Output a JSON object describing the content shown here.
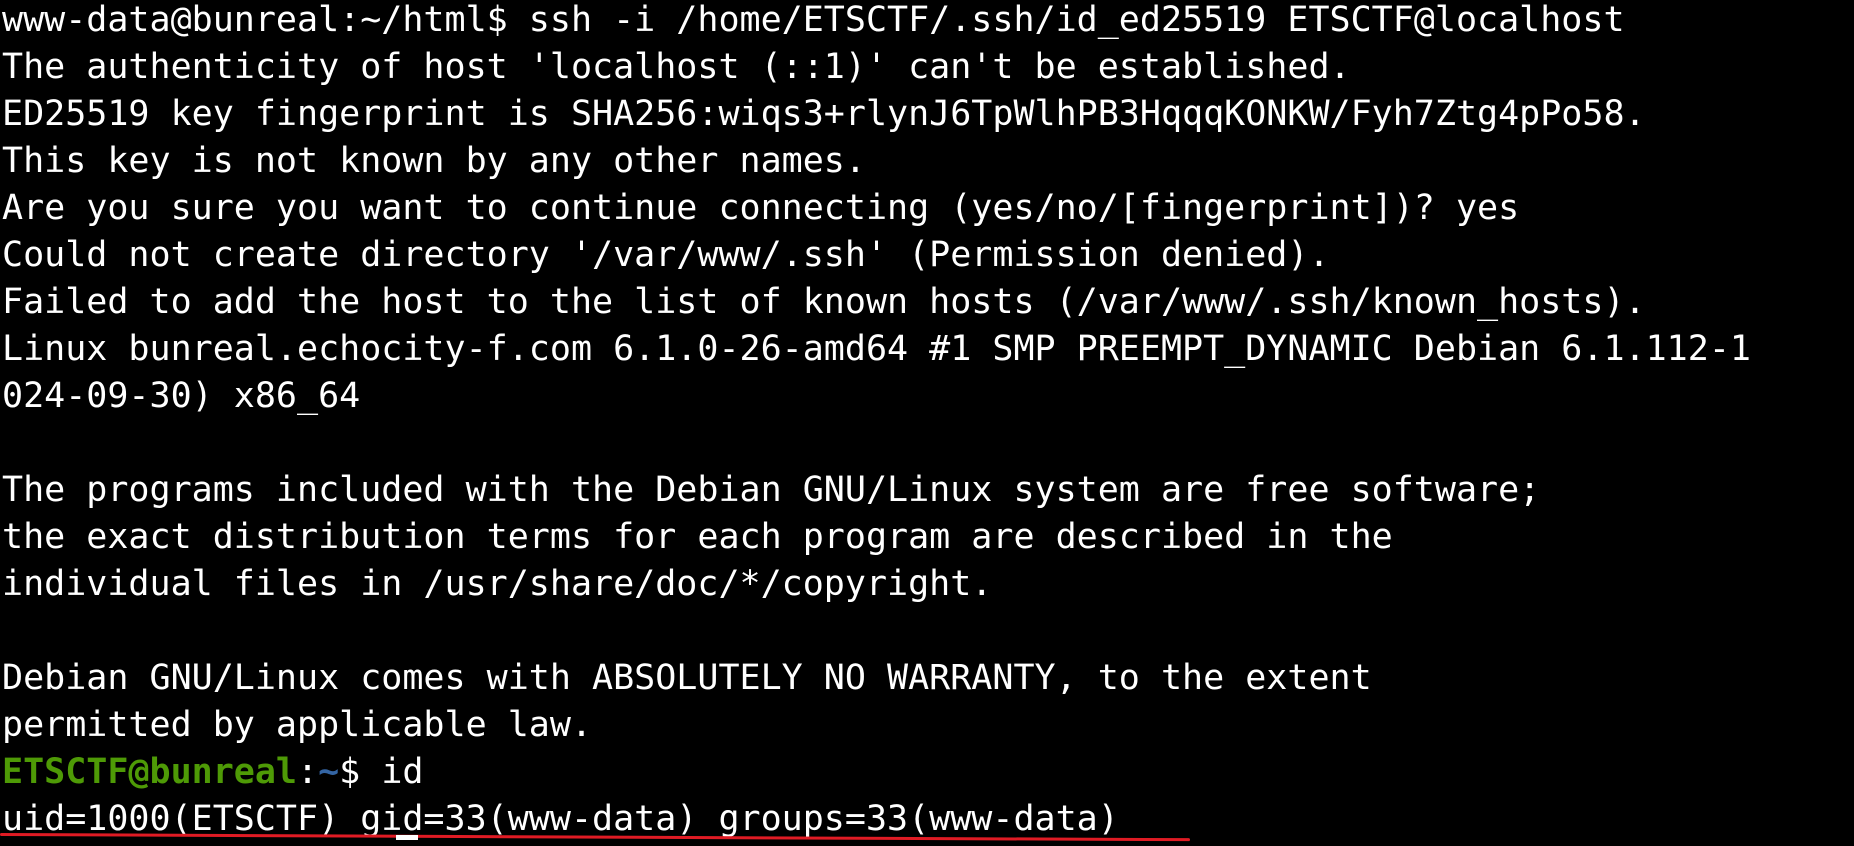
{
  "terminal": {
    "lines": [
      "www-data@bunreal:~/html$ ssh -i /home/ETSCTF/.ssh/id_ed25519 ETSCTF@localhost",
      "The authenticity of host 'localhost (::1)' can't be established.",
      "ED25519 key fingerprint is SHA256:wiqs3+rlynJ6TpWlhPB3HqqqKONKW/Fyh7Ztg4pPo58.",
      "This key is not known by any other names.",
      "Are you sure you want to continue connecting (yes/no/[fingerprint])? yes",
      "Could not create directory '/var/www/.ssh' (Permission denied).",
      "Failed to add the host to the list of known hosts (/var/www/.ssh/known_hosts).",
      "Linux bunreal.echocity-f.com 6.1.0-26-amd64 #1 SMP PREEMPT_DYNAMIC Debian 6.1.112-1",
      "024-09-30) x86_64",
      "",
      "The programs included with the Debian GNU/Linux system are free software;",
      "the exact distribution terms for each program are described in the",
      "individual files in /usr/share/doc/*/copyright.",
      "",
      "Debian GNU/Linux comes with ABSOLUTELY NO WARRANTY, to the extent",
      "permitted by applicable law."
    ],
    "prompt": {
      "user_host": "ETSCTF@bunreal",
      "separator": ":",
      "path": "~",
      "symbol": "$ ",
      "command": "id"
    },
    "output": "uid=1000(ETSCTF) gid=33(www-data) groups=33(www-data)",
    "colors": {
      "background": "#000000",
      "foreground": "#ffffff",
      "prompt_user": "#4e9a06",
      "prompt_path": "#3465a4",
      "annotation_underline": "#e01b24"
    }
  }
}
